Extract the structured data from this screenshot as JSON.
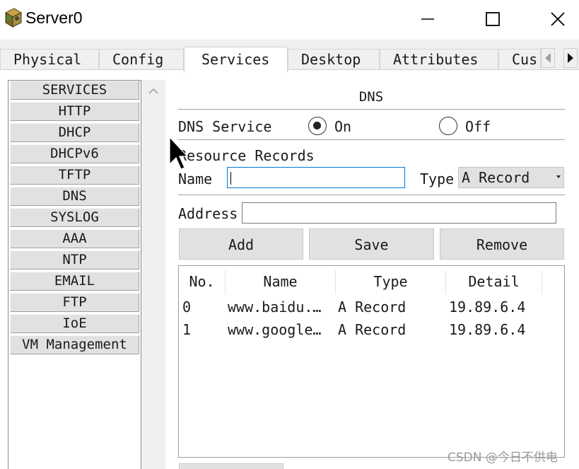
{
  "window": {
    "title": "Server0",
    "icon": "server-icon",
    "controls": [
      "minimize-icon",
      "maximize-icon",
      "close-icon"
    ]
  },
  "tabs": [
    {
      "label": "Physical",
      "active": false
    },
    {
      "label": "Config",
      "active": false
    },
    {
      "label": "Services",
      "active": true
    },
    {
      "label": "Desktop",
      "active": false
    },
    {
      "label": "Attributes",
      "active": false
    },
    {
      "label": "Cus",
      "active": false
    }
  ],
  "services": {
    "items": [
      "SERVICES",
      "HTTP",
      "DHCP",
      "DHCPv6",
      "TFTP",
      "DNS",
      "SYSLOG",
      "AAA",
      "NTP",
      "EMAIL",
      "FTP",
      "IoE",
      "VM Management"
    ]
  },
  "dns": {
    "title": "DNS",
    "service_label": "DNS Service",
    "on_label": "On",
    "off_label": "Off",
    "service_state": "On",
    "records_heading": "Resource Records",
    "name_label": "Name",
    "name_value": "",
    "type_label": "Type",
    "type_value": "A Record",
    "address_label": "Address",
    "address_value": "",
    "buttons": {
      "add": "Add",
      "save": "Save",
      "remove": "Remove"
    },
    "table": {
      "headers": [
        "No.",
        "Name",
        "Type",
        "Detail"
      ],
      "rows": [
        {
          "no": "0",
          "name": "www.baidu.…",
          "type": "A Record",
          "detail": "19.89.6.4"
        },
        {
          "no": "1",
          "name": "www.google…",
          "type": "A Record",
          "detail": "19.89.6.4"
        }
      ]
    }
  },
  "watermark": "CSDN @今日不供电",
  "colors": {
    "focus_border": "#0078d7",
    "button_face": "#e1e1e1"
  }
}
